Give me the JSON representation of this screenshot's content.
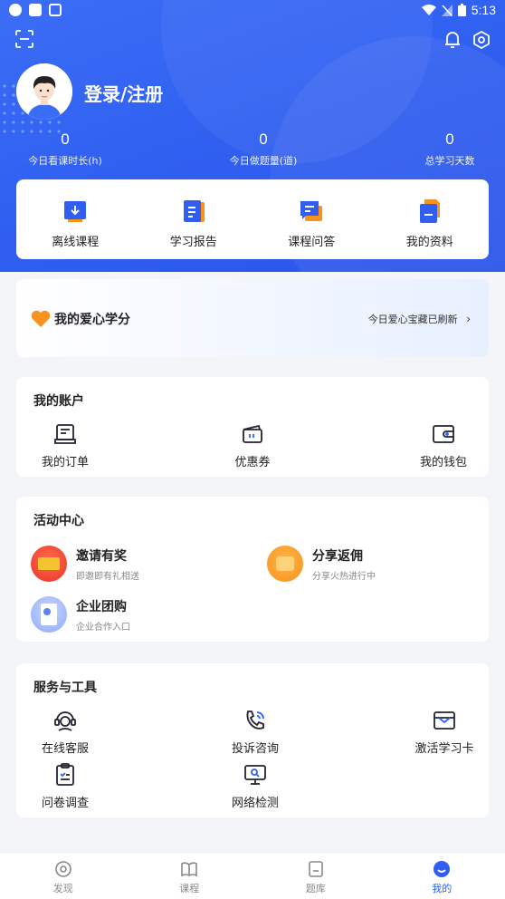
{
  "status_bar": {
    "time": "5:13"
  },
  "profile": {
    "login_label": "登录/注册"
  },
  "stats": [
    {
      "value": "0",
      "label": "今日看课时长(h)"
    },
    {
      "value": "0",
      "label": "今日做题量(道)"
    },
    {
      "value": "0",
      "label": "总学习天数"
    }
  ],
  "quick_actions": [
    {
      "label": "离线课程",
      "icon": "offline-course-icon"
    },
    {
      "label": "学习报告",
      "icon": "study-report-icon"
    },
    {
      "label": "课程问答",
      "icon": "course-qa-icon"
    },
    {
      "label": "我的资料",
      "icon": "my-materials-icon"
    }
  ],
  "love_credits": {
    "title": "我的爱心学分",
    "refresh_text": "今日爱心宝藏已刷新"
  },
  "account": {
    "title": "我的账户",
    "items": [
      {
        "label": "我的订单",
        "icon": "order-icon"
      },
      {
        "label": "优惠券",
        "icon": "coupon-icon"
      },
      {
        "label": "我的钱包",
        "icon": "wallet-icon"
      }
    ]
  },
  "activity": {
    "title": "活动中心",
    "items": [
      {
        "title": "邀请有奖",
        "subtitle": "即邀即有礼相送"
      },
      {
        "title": "分享返佣",
        "subtitle": "分享火热进行中"
      },
      {
        "title": "企业团购",
        "subtitle": "企业合作入口"
      }
    ]
  },
  "services": {
    "title": "服务与工具",
    "items": [
      {
        "label": "在线客服",
        "icon": "customer-service-icon"
      },
      {
        "label": "投诉咨询",
        "icon": "complaint-phone-icon"
      },
      {
        "label": "激活学习卡",
        "icon": "study-card-icon"
      },
      {
        "label": "问卷调查",
        "icon": "survey-icon"
      },
      {
        "label": "网络检测",
        "icon": "network-check-icon"
      }
    ]
  },
  "tabs": [
    {
      "label": "发现"
    },
    {
      "label": "课程"
    },
    {
      "label": "题库"
    },
    {
      "label": "我的"
    }
  ],
  "colors": {
    "primary": "#2f5ef0",
    "accent_orange": "#f7931e",
    "background": "#f4f5f9"
  }
}
